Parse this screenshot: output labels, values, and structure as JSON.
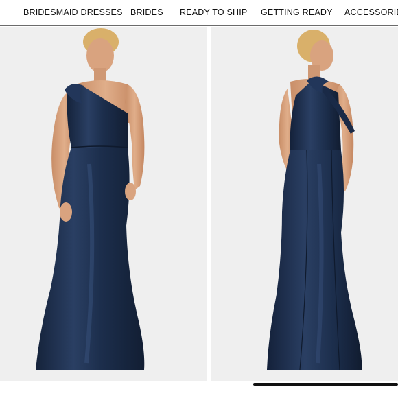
{
  "nav": {
    "items": [
      "BRIDESMAID DRESSES",
      "BRIDES",
      "READY TO SHIP",
      "GETTING READY",
      "ACCESSORIES"
    ]
  },
  "images": {
    "front": {
      "subject": "model-front-view",
      "dress_color": "#1c2e4c"
    },
    "back": {
      "subject": "model-back-view",
      "dress_color": "#1c2e4c"
    }
  },
  "colors": {
    "background": "#ffffff",
    "image_background": "#efefef",
    "dress_navy": "#1c2e4c",
    "skin": "#d9a37f",
    "hair": "#d9b06a",
    "nav_text": "#111111"
  },
  "carousel": {
    "scrollbar_visible": true
  }
}
